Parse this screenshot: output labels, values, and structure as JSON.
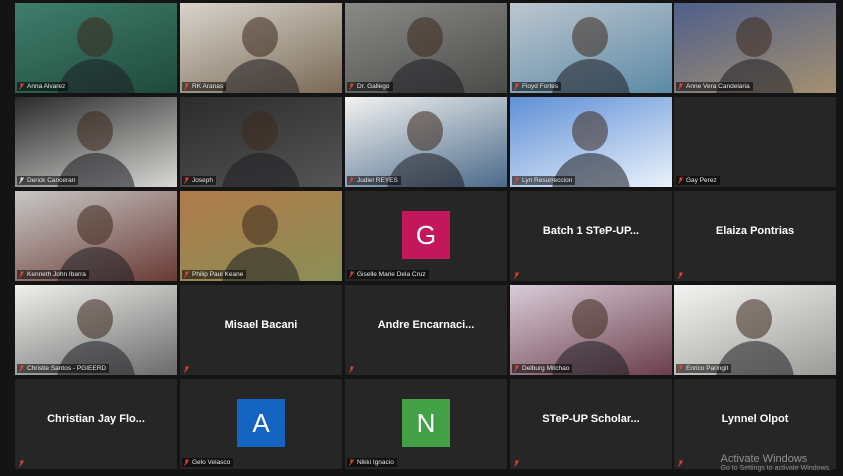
{
  "app": {
    "name": "Zoom Meeting Gallery View"
  },
  "colors": {
    "background": "#141414",
    "tile": "#262626",
    "active_speaker": "#6fd33b",
    "muted_mic": "#e0463b"
  },
  "participants": [
    {
      "name": "Anna Alvarez",
      "type": "video",
      "tint": [
        "#3f7e6b",
        "#1f4a3c"
      ],
      "muted": true
    },
    {
      "name": "RK Aranas",
      "type": "video",
      "tint": [
        "#d8d4cc",
        "#7a6a56"
      ],
      "muted": true
    },
    {
      "name": "Dr. Gallego",
      "type": "video",
      "tint": [
        "#8a8a88",
        "#4b4b49"
      ],
      "muted": true
    },
    {
      "name": "Floyd Fortes",
      "type": "video",
      "tint": [
        "#bcc6cf",
        "#5d8aa6"
      ],
      "muted": true
    },
    {
      "name": "Anne Vera Candelaria",
      "type": "video",
      "tint": [
        "#4f5f8a",
        "#a49070"
      ],
      "muted": true
    },
    {
      "name": "Derick Canceran",
      "type": "video",
      "tint": [
        "#2a2a2a",
        "#d8d8d6"
      ],
      "muted": false
    },
    {
      "name": "Joseph",
      "type": "video",
      "tint": [
        "#2c2c2c",
        "#555"
      ],
      "muted": true
    },
    {
      "name": "Judiel REYES",
      "type": "video",
      "tint": [
        "#f2f2f0",
        "#4b6a8a"
      ],
      "muted": true
    },
    {
      "name": "Lyn Resurreccion",
      "type": "video",
      "tint": [
        "#5f8fd6",
        "#eaf2fb"
      ],
      "muted": true
    },
    {
      "name": "Gay Perez",
      "type": "name",
      "display": "",
      "muted": true
    },
    {
      "name": "Kenneth John Ibarra",
      "type": "video",
      "tint": [
        "#c8c8c6",
        "#6a3a35"
      ],
      "muted": true
    },
    {
      "name": "Philip Paul Keane",
      "type": "video",
      "tint": [
        "#b07a4a",
        "#8a8f55"
      ],
      "muted": true,
      "active": true
    },
    {
      "name": "Giselle Marie Dela Cruz",
      "type": "avatar",
      "initial": "G",
      "avatar_color": "#c2185b",
      "muted": true
    },
    {
      "name": "",
      "type": "name",
      "display": "Batch 1 STeP-UP...",
      "muted": true
    },
    {
      "name": "",
      "type": "name",
      "display": "Elaiza Pontrias",
      "muted": true
    },
    {
      "name": "Christie Santos - PGIEERD",
      "type": "video",
      "tint": [
        "#f0f0ee",
        "#6a6a6a"
      ],
      "muted": true
    },
    {
      "name": "",
      "type": "name",
      "display": "Misael Bacani",
      "muted": true
    },
    {
      "name": "",
      "type": "name",
      "display": "Andre Encarnaci...",
      "muted": true
    },
    {
      "name": "Delburg Mitchao",
      "type": "video",
      "tint": [
        "#d9cbd8",
        "#6a3e4a"
      ],
      "muted": true
    },
    {
      "name": "Enrico Paringit",
      "type": "video",
      "tint": [
        "#f4f4f2",
        "#9a9a96"
      ],
      "muted": true
    },
    {
      "name": "",
      "type": "name",
      "display": "Christian Jay Flo...",
      "muted": true
    },
    {
      "name": "Gelo Velasco",
      "type": "avatar",
      "initial": "A",
      "avatar_color": "#1565c0",
      "muted": true
    },
    {
      "name": "Nikki Ignacio",
      "type": "avatar",
      "initial": "N",
      "avatar_color": "#43a047",
      "muted": true
    },
    {
      "name": "",
      "type": "name",
      "display": "STeP-UP Scholar...",
      "muted": true
    },
    {
      "name": "",
      "type": "name",
      "display": "Lynnel Olpot",
      "muted": true
    }
  ],
  "watermark": {
    "title": "Activate Windows",
    "subtitle": "Go to Settings to activate Windows."
  }
}
